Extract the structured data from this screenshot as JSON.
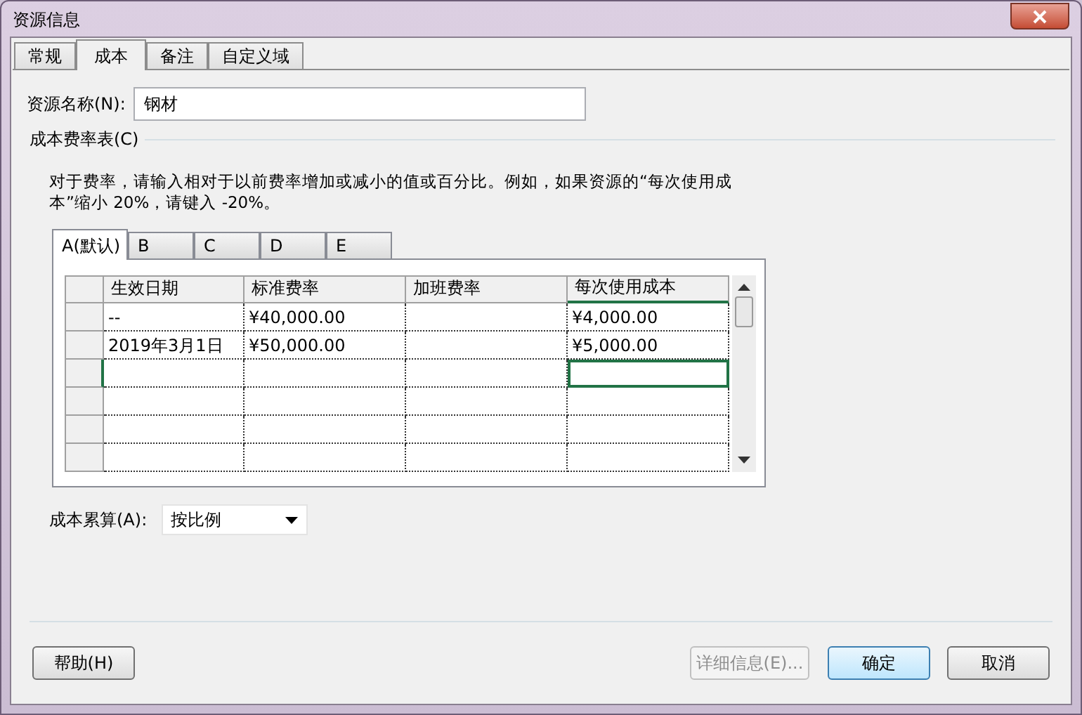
{
  "window": {
    "title": "资源信息"
  },
  "tabs": [
    {
      "label": "常规",
      "selected": false
    },
    {
      "label": "成本",
      "selected": true
    },
    {
      "label": "备注",
      "selected": false
    },
    {
      "label": "自定义域",
      "selected": false
    }
  ],
  "resource_name": {
    "label": "资源名称(N):",
    "value": "钢材"
  },
  "rate_table": {
    "label": "成本费率表(C)",
    "description": "对于费率，请输入相对于以前费率增加或减小的值或百分比。例如，如果资源的“每次使用成本”缩小 20%，请键入 -20%。",
    "tabs": [
      {
        "label": "A(默认)",
        "selected": true
      },
      {
        "label": "B",
        "selected": false
      },
      {
        "label": "C",
        "selected": false
      },
      {
        "label": "D",
        "selected": false
      },
      {
        "label": "E",
        "selected": false
      }
    ],
    "columns": [
      {
        "label": "生效日期",
        "selected": false
      },
      {
        "label": "标准费率",
        "selected": false
      },
      {
        "label": "加班费率",
        "selected": false
      },
      {
        "label": "每次使用成本",
        "selected": true
      }
    ],
    "rows": [
      {
        "cells": [
          "--",
          "¥40,000.00",
          null,
          "¥4,000.00"
        ],
        "selected": false
      },
      {
        "cells": [
          "2019年3月1日",
          "¥50,000.00",
          null,
          "¥5,000.00"
        ],
        "selected": false
      },
      {
        "cells": [
          null,
          null,
          null,
          null
        ],
        "selected": true
      },
      {
        "cells": [
          null,
          null,
          null,
          null
        ],
        "selected": false
      },
      {
        "cells": [
          null,
          null,
          null,
          null
        ],
        "selected": false
      },
      {
        "cells": [
          null,
          null,
          null,
          null
        ],
        "selected": false
      }
    ]
  },
  "accrual": {
    "label": "成本累算(A):",
    "value": "按比例"
  },
  "buttons": [
    {
      "label": "帮助(H)",
      "kind": "normal",
      "disabled": false
    },
    {
      "label": "详细信息(E)...",
      "kind": "normal",
      "disabled": true
    },
    {
      "label": "确定",
      "kind": "default",
      "disabled": false
    },
    {
      "label": "取消",
      "kind": "normal",
      "disabled": false
    }
  ]
}
